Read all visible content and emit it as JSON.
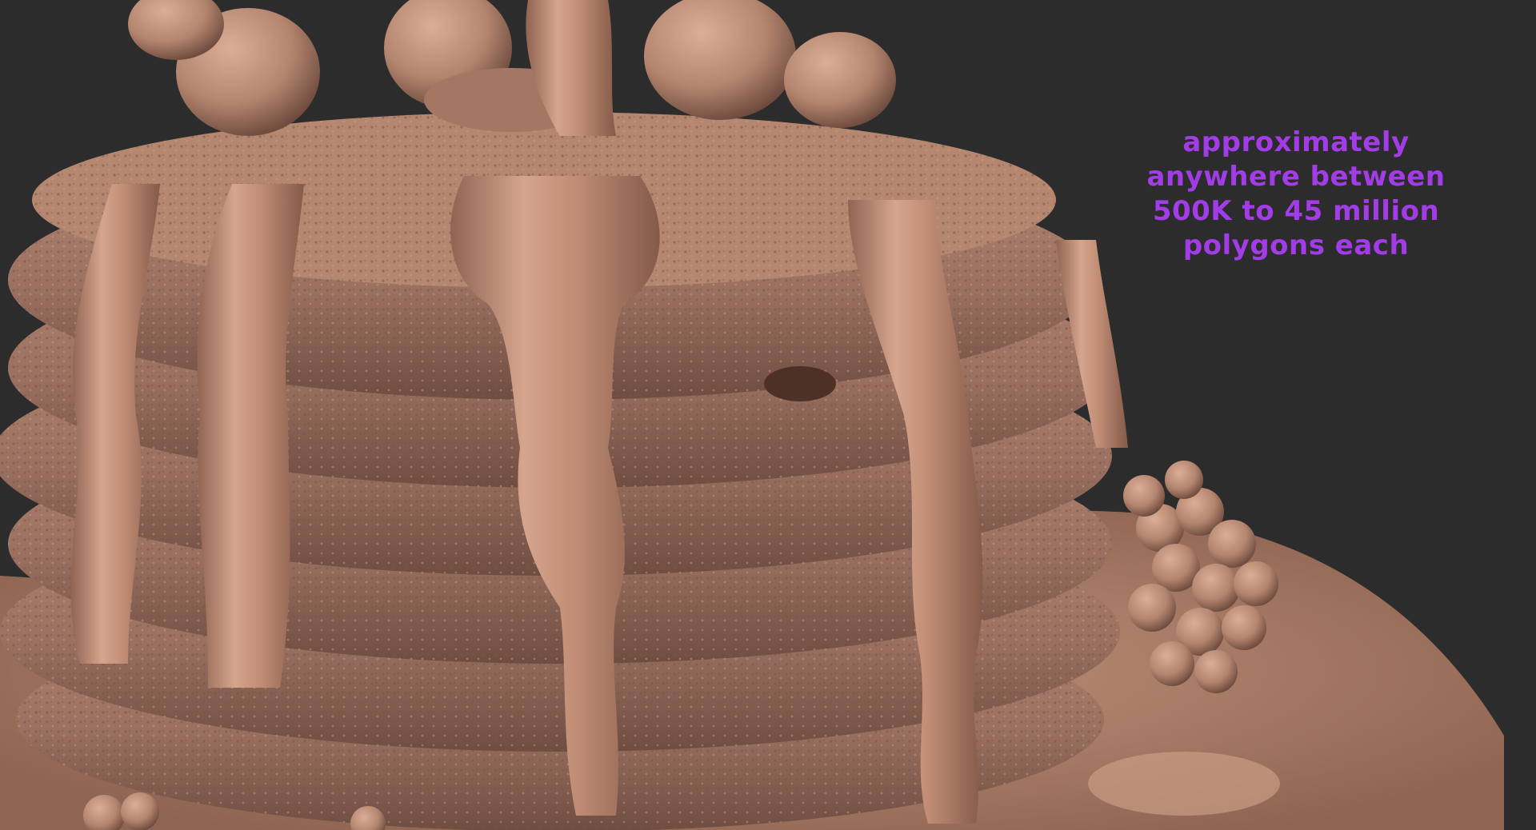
{
  "scene": {
    "subject": "sculpted pancake stack with drizzling syrup and raspberries",
    "background_color": "#2c2c2c",
    "clay_color": "#b98a73",
    "caption_color": "#a23ce6"
  },
  "caption": {
    "line1": "approximately",
    "line2": "anywhere between",
    "line3": "500K to 45 million",
    "line4": "polygons each"
  }
}
